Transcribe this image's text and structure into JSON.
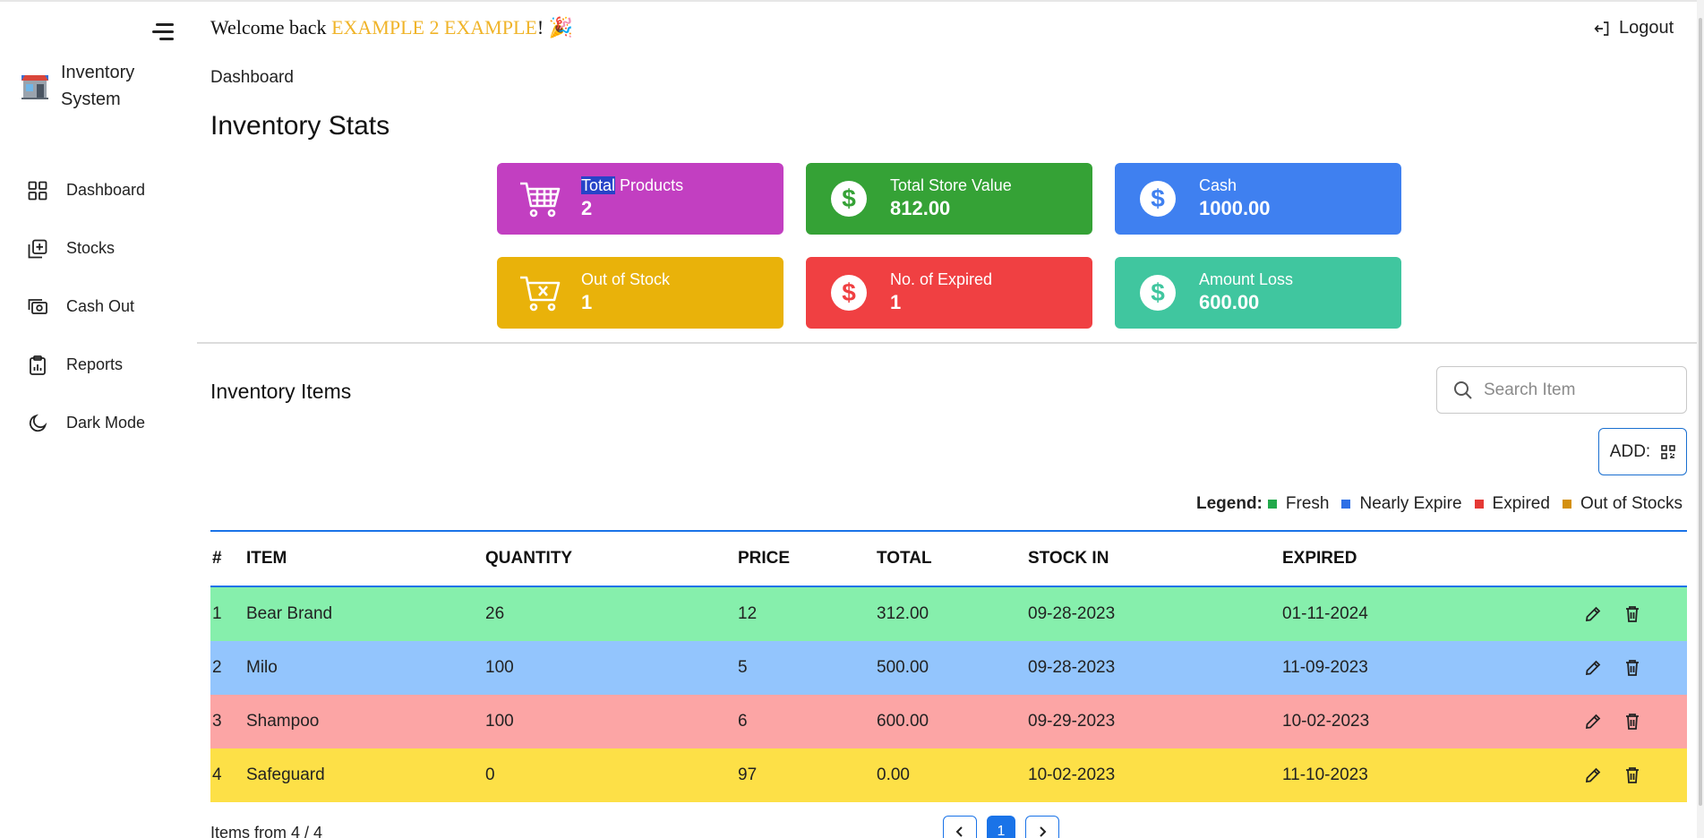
{
  "sidebar": {
    "brand": "Inventory System",
    "items": [
      {
        "label": "Dashboard",
        "icon": "dashboard-grid-icon"
      },
      {
        "label": "Stocks",
        "icon": "add-stock-icon"
      },
      {
        "label": "Cash Out",
        "icon": "cash-out-icon"
      },
      {
        "label": "Reports",
        "icon": "clipboard-icon"
      },
      {
        "label": "Dark Mode",
        "icon": "moon-icon"
      }
    ]
  },
  "header": {
    "welcome_prefix": "Welcome back ",
    "user_name": "EXAMPLE 2 EXAMPLE",
    "welcome_suffix": "!",
    "emoji": "🎉",
    "logout_label": "Logout"
  },
  "breadcrumb": "Dashboard",
  "page_title": "Inventory Stats",
  "stats": [
    {
      "label_hl": "Total",
      "label_rest": " Products",
      "value": "2",
      "color": "#c23fc1",
      "icon": "cart-icon"
    },
    {
      "label_hl": "",
      "label_rest": "Total Store Value",
      "value": "812.00",
      "color": "#35a236",
      "icon": "dollar-icon"
    },
    {
      "label_hl": "",
      "label_rest": "Cash",
      "value": "1000.00",
      "color": "#3f80f0",
      "icon": "dollar-icon"
    },
    {
      "label_hl": "",
      "label_rest": "Out of Stock",
      "value": "1",
      "color": "#e9b20a",
      "icon": "cart-x-icon"
    },
    {
      "label_hl": "",
      "label_rest": "No. of Expired",
      "value": "1",
      "color": "#f04042",
      "icon": "dollar-icon"
    },
    {
      "label_hl": "",
      "label_rest": "Amount Loss",
      "value": "600.00",
      "color": "#40c69f",
      "icon": "dollar-icon"
    }
  ],
  "items_section": {
    "title": "Inventory Items",
    "search_placeholder": "Search Item",
    "add_label": "ADD:"
  },
  "legend": {
    "title": "Legend:",
    "entries": [
      {
        "label": "Fresh",
        "color": "#22a94b"
      },
      {
        "label": "Nearly Expire",
        "color": "#2d6fe6"
      },
      {
        "label": "Expired",
        "color": "#e53935"
      },
      {
        "label": "Out of Stocks",
        "color": "#d4900f"
      }
    ]
  },
  "table": {
    "headers": [
      "#",
      "ITEM",
      "QUANTITY",
      "PRICE",
      "TOTAL",
      "STOCK IN",
      "EXPIRED"
    ],
    "rows": [
      {
        "n": "1",
        "item": "Bear Brand",
        "qty": "26",
        "price": "12",
        "total": "312.00",
        "stock_in": "09-28-2023",
        "expired": "01-11-2024",
        "color": "#86efac"
      },
      {
        "n": "2",
        "item": "Milo",
        "qty": "100",
        "price": "5",
        "total": "500.00",
        "stock_in": "09-28-2023",
        "expired": "11-09-2023",
        "color": "#93c5fd"
      },
      {
        "n": "3",
        "item": "Shampoo",
        "qty": "100",
        "price": "6",
        "total": "600.00",
        "stock_in": "09-29-2023",
        "expired": "10-02-2023",
        "color": "#fca5a5"
      },
      {
        "n": "4",
        "item": "Safeguard",
        "qty": "0",
        "price": "97",
        "total": "0.00",
        "stock_in": "10-02-2023",
        "expired": "11-10-2023",
        "color": "#fde047"
      }
    ]
  },
  "footer": {
    "count_text": "Items from 4 / 4",
    "pages": [
      "1"
    ]
  }
}
